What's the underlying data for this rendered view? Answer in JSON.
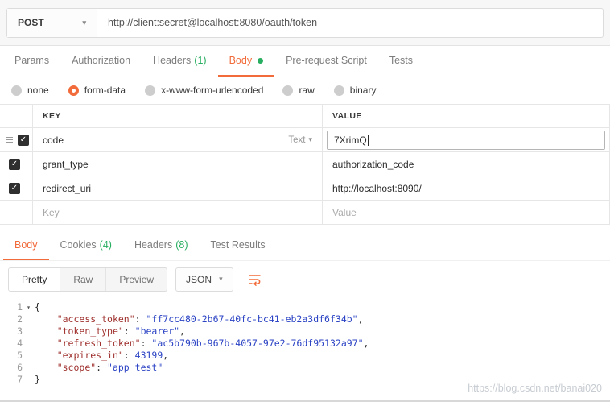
{
  "colors": {
    "accent": "#f26b3a",
    "green": "#27ae60",
    "border": "#e6e6e6"
  },
  "icons": {
    "check": "✓",
    "caret_down": "▾",
    "fold": "▾"
  },
  "request": {
    "method": "POST",
    "url": "http://client:secret@localhost:8080/oauth/token",
    "tabs": {
      "params": "Params",
      "authorization": "Authorization",
      "headers": "Headers",
      "headers_count": "(1)",
      "body": "Body",
      "pre_request": "Pre-request Script",
      "tests": "Tests"
    },
    "body_modes": {
      "none": "none",
      "form_data": "form-data",
      "urlencoded": "x-www-form-urlencoded",
      "raw": "raw",
      "binary": "binary"
    },
    "selected_mode": "form-data",
    "form": {
      "key_header": "KEY",
      "value_header": "VALUE",
      "rows": [
        {
          "key": "code",
          "type": "Text",
          "value": "7XrimQ",
          "checked": true
        },
        {
          "key": "grant_type",
          "value": "authorization_code",
          "checked": true
        },
        {
          "key": "redirect_uri",
          "value": "http://localhost:8090/",
          "checked": true
        }
      ],
      "new_row": {
        "key_placeholder": "Key",
        "value_placeholder": "Value"
      }
    }
  },
  "response": {
    "tabs": {
      "body": "Body",
      "cookies": "Cookies",
      "cookies_count": "(4)",
      "headers": "Headers",
      "headers_count": "(8)",
      "test_results": "Test Results"
    },
    "toolbar": {
      "pretty": "Pretty",
      "raw": "Raw",
      "preview": "Preview",
      "language": "JSON"
    },
    "body": {
      "lines": [
        {
          "n": 1,
          "fold": true,
          "tokens": [
            {
              "c": "p",
              "t": "{"
            }
          ]
        },
        {
          "n": 2,
          "tokens": [
            {
              "c": "w",
              "t": "    "
            },
            {
              "c": "k",
              "t": "\"access_token\""
            },
            {
              "c": "p",
              "t": ": "
            },
            {
              "c": "s",
              "t": "\"ff7cc480-2b67-40fc-bc41-eb2a3df6f34b\""
            },
            {
              "c": "p",
              "t": ","
            }
          ]
        },
        {
          "n": 3,
          "tokens": [
            {
              "c": "w",
              "t": "    "
            },
            {
              "c": "k",
              "t": "\"token_type\""
            },
            {
              "c": "p",
              "t": ": "
            },
            {
              "c": "s",
              "t": "\"bearer\""
            },
            {
              "c": "p",
              "t": ","
            }
          ]
        },
        {
          "n": 4,
          "tokens": [
            {
              "c": "w",
              "t": "    "
            },
            {
              "c": "k",
              "t": "\"refresh_token\""
            },
            {
              "c": "p",
              "t": ": "
            },
            {
              "c": "s",
              "t": "\"ac5b790b-967b-4057-97e2-76df95132a97\""
            },
            {
              "c": "p",
              "t": ","
            }
          ]
        },
        {
          "n": 5,
          "tokens": [
            {
              "c": "w",
              "t": "    "
            },
            {
              "c": "k",
              "t": "\"expires_in\""
            },
            {
              "c": "p",
              "t": ": "
            },
            {
              "c": "n",
              "t": "43199"
            },
            {
              "c": "p",
              "t": ","
            }
          ]
        },
        {
          "n": 6,
          "tokens": [
            {
              "c": "w",
              "t": "    "
            },
            {
              "c": "k",
              "t": "\"scope\""
            },
            {
              "c": "p",
              "t": ": "
            },
            {
              "c": "s",
              "t": "\"app test\""
            }
          ]
        },
        {
          "n": 7,
          "tokens": [
            {
              "c": "p",
              "t": "}"
            }
          ]
        }
      ]
    }
  },
  "watermark": "https://blog.csdn.net/banai020"
}
